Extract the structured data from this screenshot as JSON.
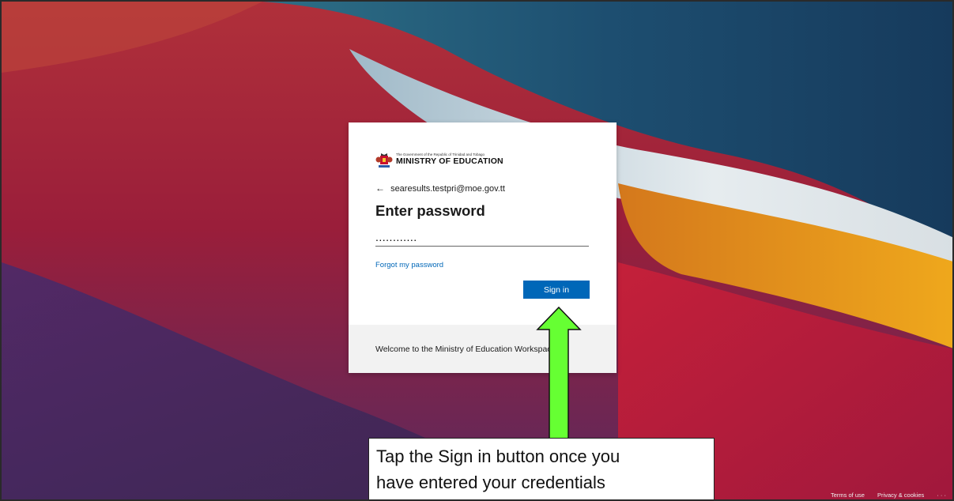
{
  "logo": {
    "small_text": "The Government of the Republic of Trinidad and Tobago",
    "big_text": "MINISTRY OF EDUCATION"
  },
  "login": {
    "back_icon": "back-arrow-icon",
    "email": "searesults.testpri@moe.gov.tt",
    "title": "Enter password",
    "password_value": "............",
    "forgot_link": "Forgot my password",
    "signin_label": "Sign in",
    "accent_color": "#0067b8"
  },
  "footer": {
    "welcome": "Welcome to the Ministry of Education Workspace."
  },
  "annotation": {
    "arrow_icon": "green-up-arrow-icon",
    "arrow_color": "#66ff33",
    "line1": "Tap the Sign in button once you",
    "line2": "have entered your credentials"
  },
  "page_footer": {
    "terms": "Terms of use",
    "privacy": "Privacy & cookies",
    "more": "· · ·"
  }
}
